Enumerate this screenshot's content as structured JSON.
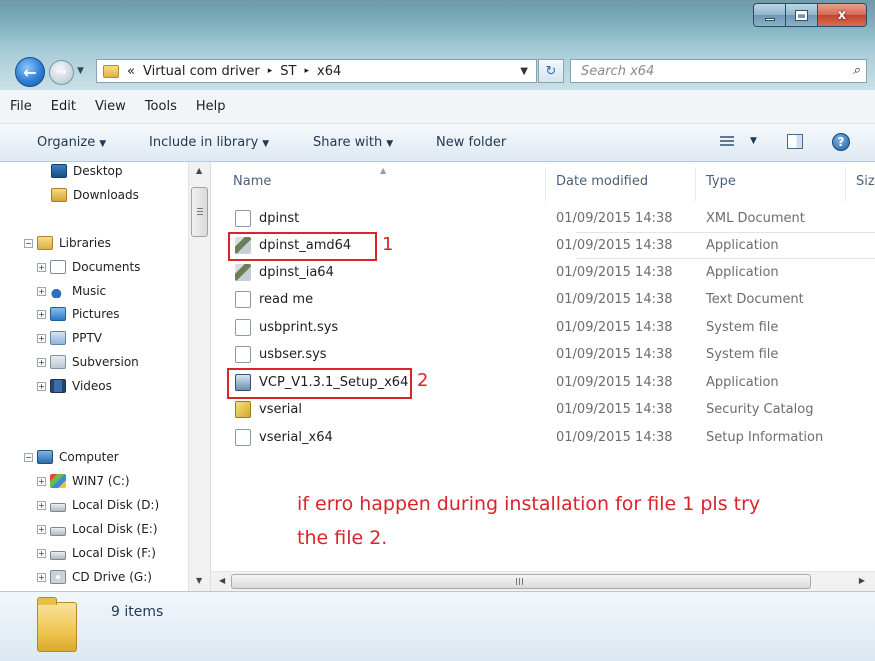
{
  "window": {
    "buttons": {
      "minimize": "_",
      "maximize": "□",
      "close": "x"
    }
  },
  "address": {
    "overflow": "«",
    "crumbs": [
      "Virtual com driver",
      "ST",
      "x64"
    ],
    "separator": "▸",
    "search_placeholder": "Search x64"
  },
  "menu": [
    "File",
    "Edit",
    "View",
    "Tools",
    "Help"
  ],
  "commands": {
    "organize": "Organize",
    "include": "Include in library",
    "share": "Share with",
    "new_folder": "New folder"
  },
  "nav": {
    "items": [
      "Desktop",
      "Downloads",
      "Libraries",
      "Documents",
      "Music",
      "Pictures",
      "PPTV",
      "Subversion",
      "Videos",
      "Computer",
      "WIN7 (C:)",
      "Local Disk (D:)",
      "Local Disk (E:)",
      "Local Disk (F:)",
      "CD Drive (G:)"
    ]
  },
  "columns": {
    "name": "Name",
    "date": "Date modified",
    "type": "Type",
    "size": "Siz"
  },
  "files": [
    {
      "name": "dpinst",
      "date": "01/09/2015 14:38",
      "type": "XML Document",
      "icon": "xml-file-icon"
    },
    {
      "name": "dpinst_amd64",
      "date": "01/09/2015 14:38",
      "type": "Application",
      "icon": "application-icon"
    },
    {
      "name": "dpinst_ia64",
      "date": "01/09/2015 14:38",
      "type": "Application",
      "icon": "application-icon"
    },
    {
      "name": "read me",
      "date": "01/09/2015 14:38",
      "type": "Text Document",
      "icon": "text-file-icon"
    },
    {
      "name": "usbprint.sys",
      "date": "01/09/2015 14:38",
      "type": "System file",
      "icon": "system-file-icon"
    },
    {
      "name": "usbser.sys",
      "date": "01/09/2015 14:38",
      "type": "System file",
      "icon": "system-file-icon"
    },
    {
      "name": "VCP_V1.3.1_Setup_x64",
      "date": "01/09/2015 14:38",
      "type": "Application",
      "icon": "setup-icon"
    },
    {
      "name": "vserial",
      "date": "01/09/2015 14:38",
      "type": "Security Catalog",
      "icon": "security-catalog-icon"
    },
    {
      "name": "vserial_x64",
      "date": "01/09/2015 14:38",
      "type": "Setup Information",
      "icon": "setup-information-icon"
    }
  ],
  "annotations": {
    "one": "1",
    "two": "2",
    "note_line1": "if erro happen during installation for file 1 pls try",
    "note_line2": "the file 2.",
    "color": "#d9242c"
  },
  "status": {
    "count": "9 items"
  },
  "scroll": {
    "h": "III"
  }
}
